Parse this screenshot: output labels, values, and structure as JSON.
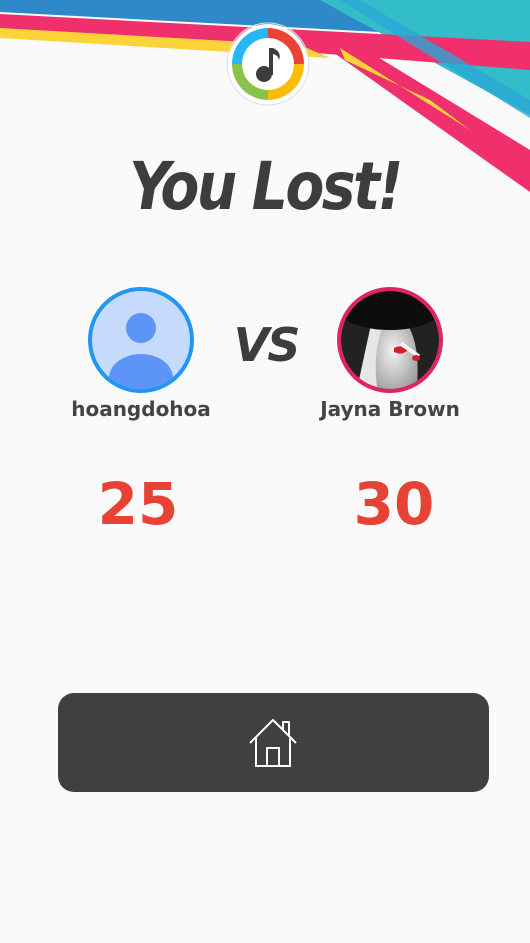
{
  "result": {
    "title": "You Lost!",
    "vs_label": "VS"
  },
  "players": [
    {
      "name": "hoangdohoa",
      "score": "25",
      "avatar": "default-user-avatar",
      "ring_color": "#2196f3"
    },
    {
      "name": "Jayna Brown",
      "score": "30",
      "avatar": "photo-avatar",
      "ring_color": "#e0245e"
    }
  ],
  "actions": {
    "home_icon": "home-icon"
  },
  "colors": {
    "score": "#e84236",
    "title": "#3d3d3d",
    "button": "#404040",
    "background": "#fafafa",
    "stripe_pink": "#f0306d",
    "stripe_yellow": "#fdd33a",
    "stripe_teal": "#33bcc9",
    "stripe_blue": "#2f89c8"
  },
  "logo": {
    "icon": "music-note-icon"
  }
}
